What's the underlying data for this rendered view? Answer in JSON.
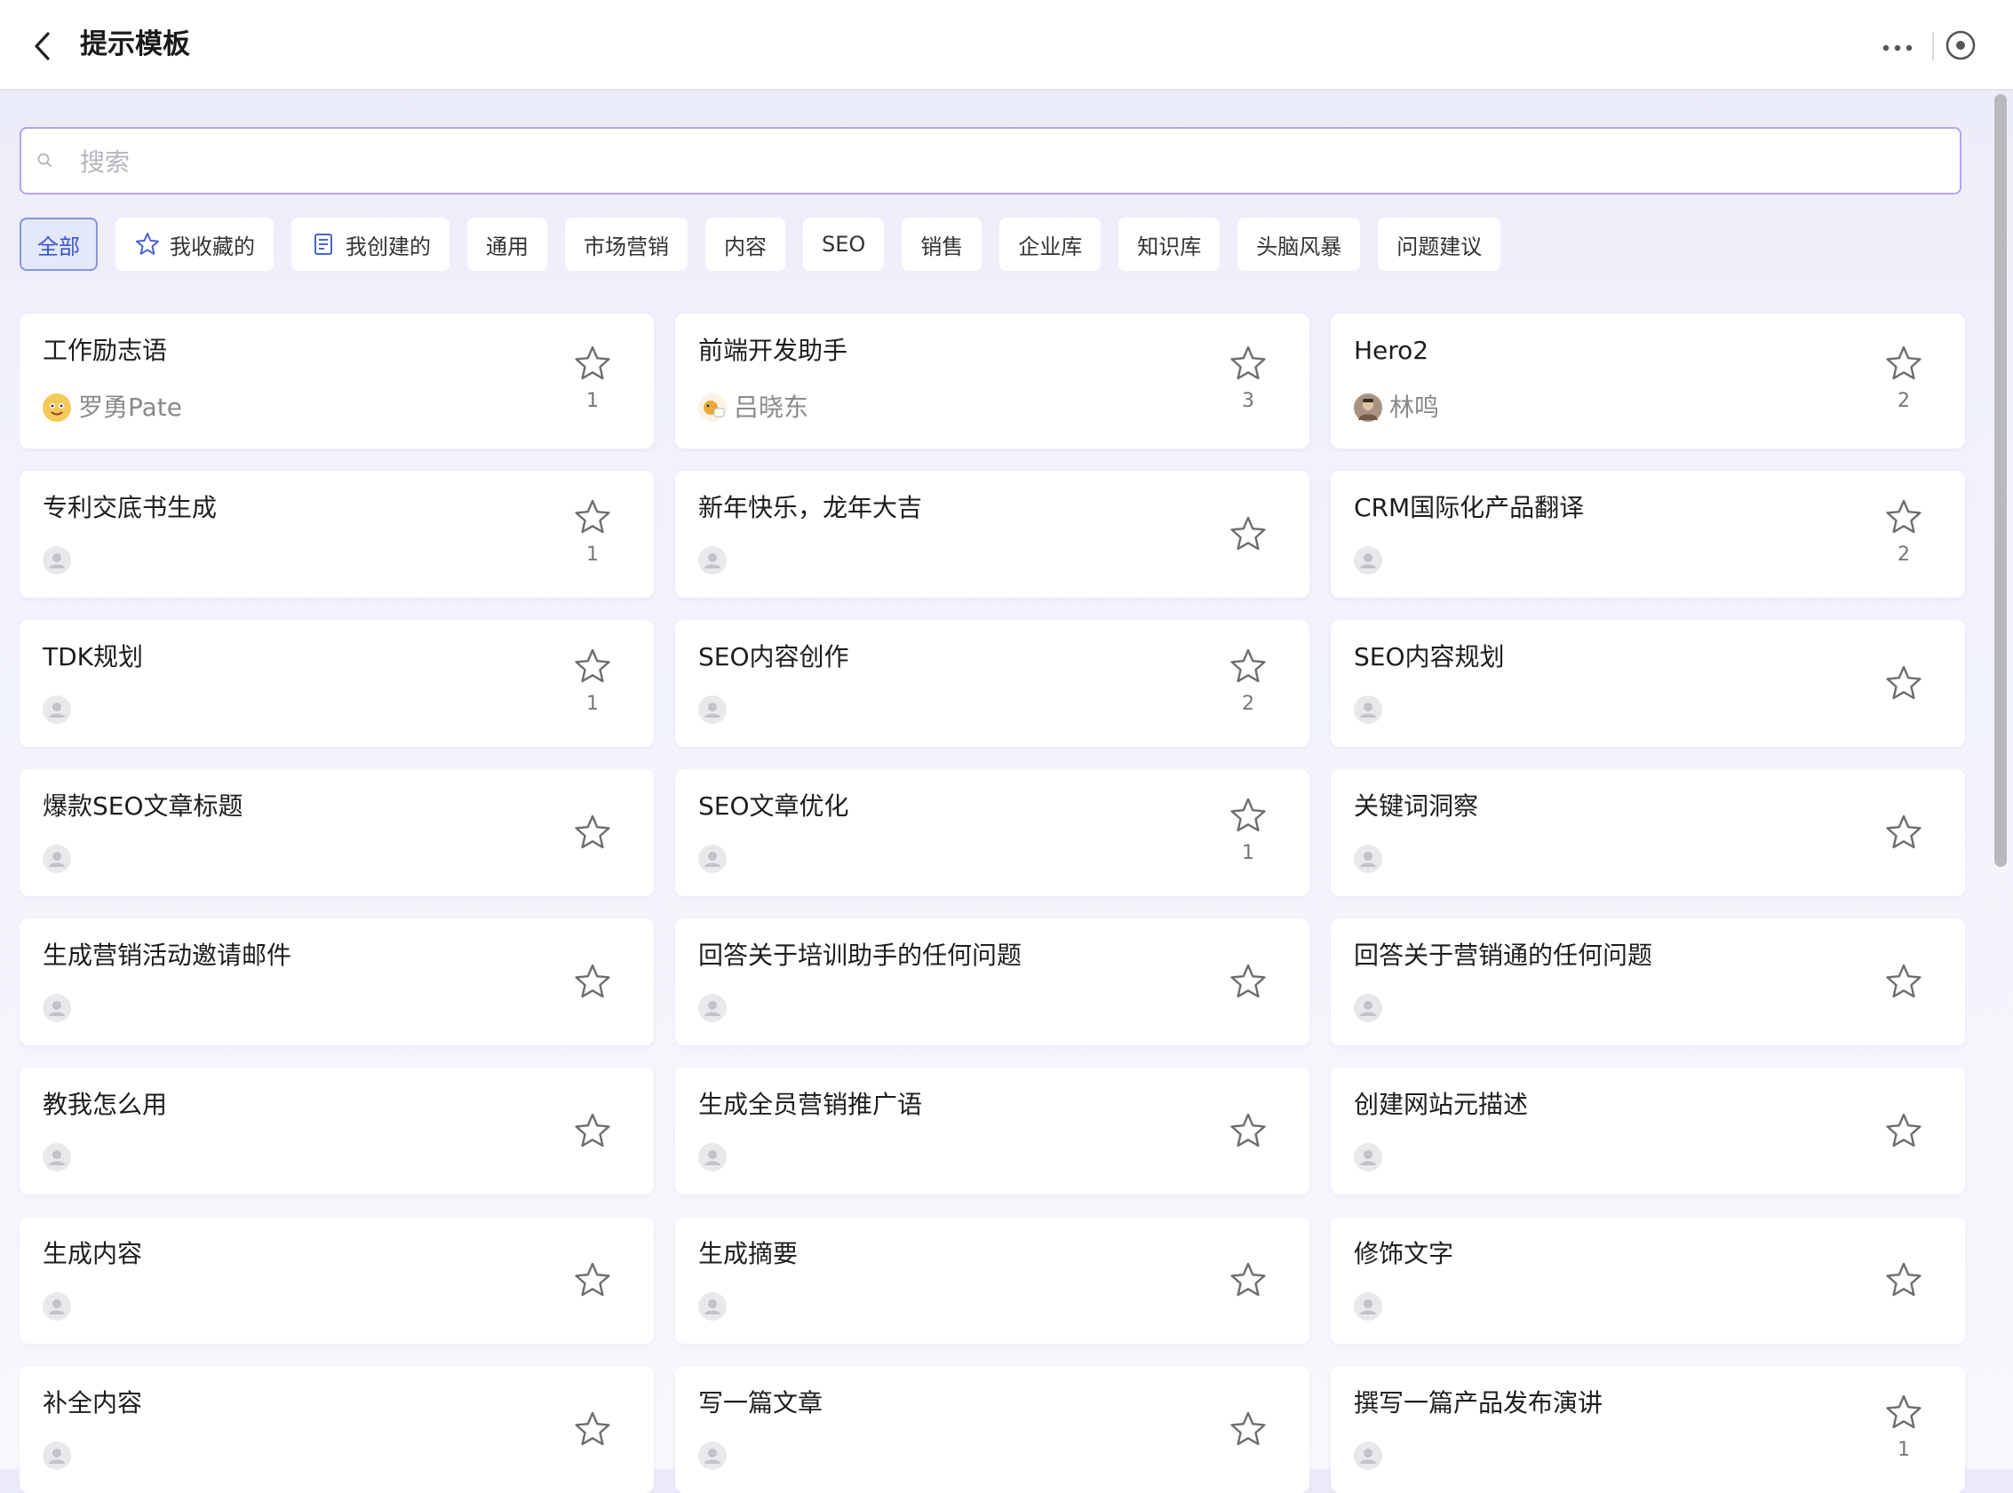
{
  "header": {
    "title": "提示模板",
    "back_icon": "chevron-left-icon",
    "more_icon": "more-horizontal-icon",
    "target_icon": "record-target-icon"
  },
  "search": {
    "placeholder": "搜索",
    "value": "",
    "icon": "search-icon"
  },
  "filters": [
    {
      "label": "全部",
      "active": true
    },
    {
      "label": "我收藏的",
      "icon": "star-outline-icon"
    },
    {
      "label": "我创建的",
      "icon": "document-icon"
    },
    {
      "label": "通用"
    },
    {
      "label": "市场营销"
    },
    {
      "label": "内容"
    },
    {
      "label": "SEO"
    },
    {
      "label": "销售"
    },
    {
      "label": "企业库"
    },
    {
      "label": "知识库"
    },
    {
      "label": "头脑风暴"
    },
    {
      "label": "问题建议"
    }
  ],
  "templates": [
    {
      "title": "工作励志语",
      "author": "罗勇Pate",
      "avatar": "cartoon-face-avatar",
      "stars": "1"
    },
    {
      "title": "前端开发助手",
      "author": "吕晓东",
      "avatar": "cartoon-animal-avatar",
      "stars": "3"
    },
    {
      "title": "Hero2",
      "author": "林鸣",
      "avatar": "photo-avatar",
      "stars": "2"
    },
    {
      "title": "专利交底书生成",
      "author": "",
      "avatar": "default-user-avatar",
      "stars": "1"
    },
    {
      "title": "新年快乐，龙年大吉",
      "author": "",
      "avatar": "default-user-avatar",
      "stars": ""
    },
    {
      "title": "CRM国际化产品翻译",
      "author": "",
      "avatar": "default-user-avatar",
      "stars": "2"
    },
    {
      "title": "TDK规划",
      "author": "",
      "avatar": "default-user-avatar",
      "stars": "1"
    },
    {
      "title": "SEO内容创作",
      "author": "",
      "avatar": "default-user-avatar",
      "stars": "2"
    },
    {
      "title": "SEO内容规划",
      "author": "",
      "avatar": "default-user-avatar",
      "stars": ""
    },
    {
      "title": "爆款SEO文章标题",
      "author": "",
      "avatar": "default-user-avatar",
      "stars": ""
    },
    {
      "title": "SEO文章优化",
      "author": "",
      "avatar": "default-user-avatar",
      "stars": "1"
    },
    {
      "title": "关键词洞察",
      "author": "",
      "avatar": "default-user-avatar",
      "stars": ""
    },
    {
      "title": "生成营销活动邀请邮件",
      "author": "",
      "avatar": "default-user-avatar",
      "stars": ""
    },
    {
      "title": "回答关于培训助手的任何问题",
      "author": "",
      "avatar": "default-user-avatar",
      "stars": ""
    },
    {
      "title": "回答关于营销通的任何问题",
      "author": "",
      "avatar": "default-user-avatar",
      "stars": ""
    },
    {
      "title": "教我怎么用",
      "author": "",
      "avatar": "default-user-avatar",
      "stars": ""
    },
    {
      "title": "生成全员营销推广语",
      "author": "",
      "avatar": "default-user-avatar",
      "stars": ""
    },
    {
      "title": "创建网站元描述",
      "author": "",
      "avatar": "default-user-avatar",
      "stars": ""
    },
    {
      "title": "生成内容",
      "author": "",
      "avatar": "default-user-avatar",
      "stars": ""
    },
    {
      "title": "生成摘要",
      "author": "",
      "avatar": "default-user-avatar",
      "stars": ""
    },
    {
      "title": "修饰文字",
      "author": "",
      "avatar": "default-user-avatar",
      "stars": ""
    },
    {
      "title": "补全内容",
      "author": "",
      "avatar": "default-user-avatar",
      "stars": ""
    },
    {
      "title": "写一篇文章",
      "author": "",
      "avatar": "default-user-avatar",
      "stars": ""
    },
    {
      "title": "撰写一篇产品发布演讲",
      "author": "",
      "avatar": "default-user-avatar",
      "stars": "1"
    }
  ],
  "colors": {
    "accent": "#3a53c9",
    "active_chip_bg": "#e3e8fb",
    "search_border": "#b7a2f0",
    "star_stroke": "#6d6d6d"
  }
}
